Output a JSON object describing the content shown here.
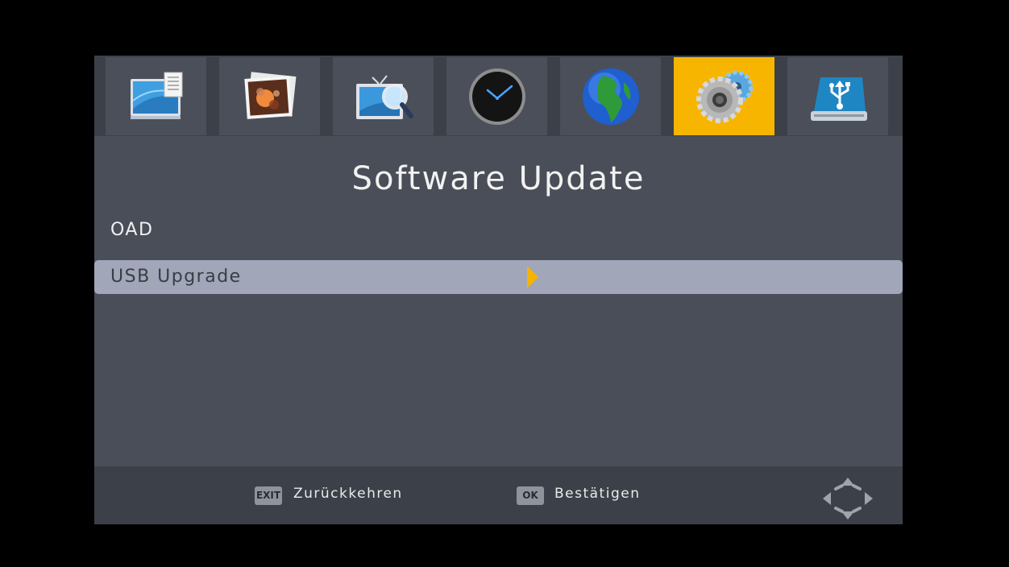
{
  "tabs": [
    {
      "icon": "screen-document-icon",
      "active": false
    },
    {
      "icon": "photo-icon",
      "active": false
    },
    {
      "icon": "tv-search-icon",
      "active": false
    },
    {
      "icon": "clock-icon",
      "active": false
    },
    {
      "icon": "globe-icon",
      "active": false
    },
    {
      "icon": "gears-icon",
      "active": true
    },
    {
      "icon": "usb-drive-icon",
      "active": false
    }
  ],
  "page": {
    "title": "Software Update"
  },
  "menu": {
    "items": [
      {
        "label": "OAD",
        "selected": false
      },
      {
        "label": "USB Upgrade",
        "selected": true
      }
    ]
  },
  "footer": {
    "exit_key": "EXIT",
    "exit_label": "Zurückkehren",
    "ok_key": "OK",
    "ok_label": "Bestätigen"
  },
  "colors": {
    "accent": "#f7b500",
    "panel": "#4a4e58",
    "selection": "#a1a6b8"
  }
}
